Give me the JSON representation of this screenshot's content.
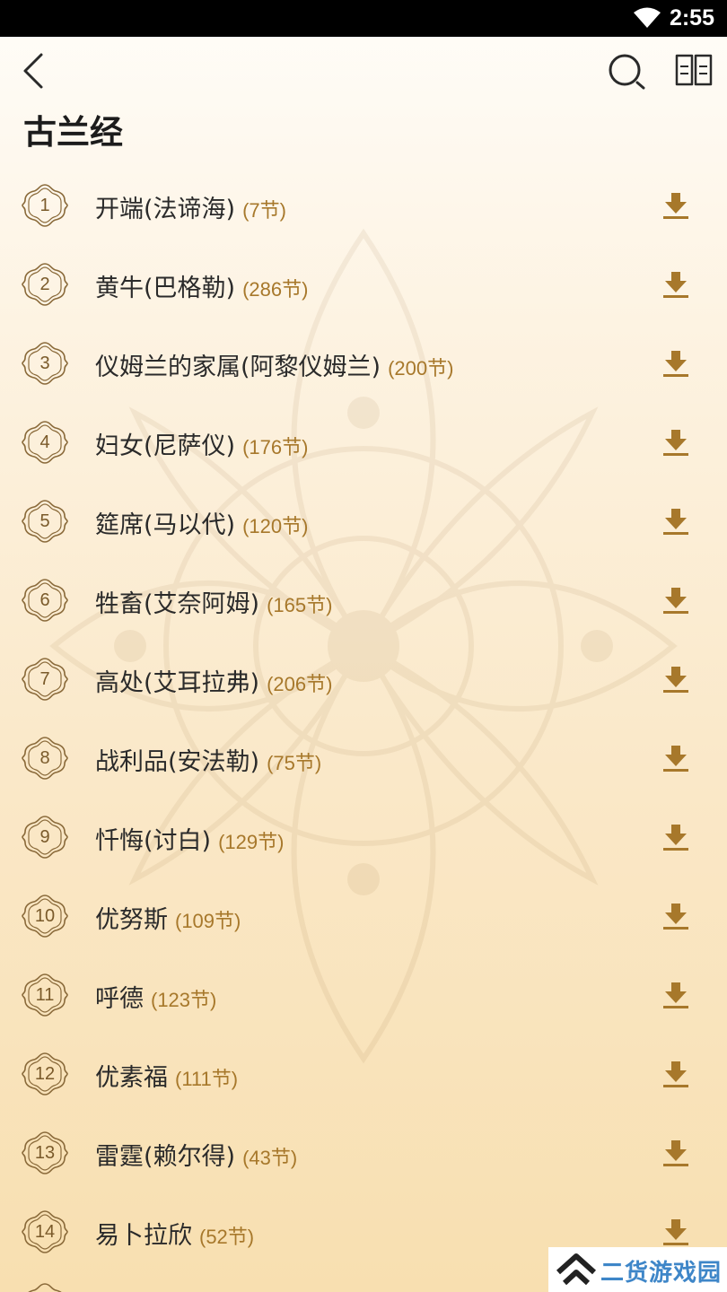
{
  "status_bar": {
    "time": "2:55"
  },
  "header": {
    "title": "古兰经"
  },
  "icons": {
    "back": "chevron-left-icon",
    "search": "search-icon",
    "reader": "open-book-icon",
    "download": "download-icon"
  },
  "colors": {
    "accent": "#a7782b",
    "title_text": "#1c1c1c",
    "badge_outline": "#8a6a3a"
  },
  "suras": [
    {
      "number": "1",
      "name": "开端(法谛海)",
      "verses": "(7节)"
    },
    {
      "number": "2",
      "name": "黄牛(巴格勒)",
      "verses": "(286节)"
    },
    {
      "number": "3",
      "name": "仪姆兰的家属(阿黎仪姆兰)",
      "verses": "(200节)"
    },
    {
      "number": "4",
      "name": "妇女(尼萨仪)",
      "verses": "(176节)"
    },
    {
      "number": "5",
      "name": "筵席(马以代)",
      "verses": "(120节)"
    },
    {
      "number": "6",
      "name": "牲畜(艾奈阿姆)",
      "verses": "(165节)"
    },
    {
      "number": "7",
      "name": "高处(艾耳拉弗)",
      "verses": "(206节)"
    },
    {
      "number": "8",
      "name": "战利品(安法勒)",
      "verses": "(75节)"
    },
    {
      "number": "9",
      "name": "忏悔(讨白)",
      "verses": "(129节)"
    },
    {
      "number": "10",
      "name": "优努斯",
      "verses": "(109节)"
    },
    {
      "number": "11",
      "name": "呼德",
      "verses": "(123节)"
    },
    {
      "number": "12",
      "name": "优素福",
      "verses": "(111节)"
    },
    {
      "number": "13",
      "name": "雷霆(赖尔得)",
      "verses": "(43节)"
    },
    {
      "number": "14",
      "name": "易卜拉欣",
      "verses": "(52节)"
    }
  ],
  "watermark": {
    "text": "二货游戏园"
  }
}
